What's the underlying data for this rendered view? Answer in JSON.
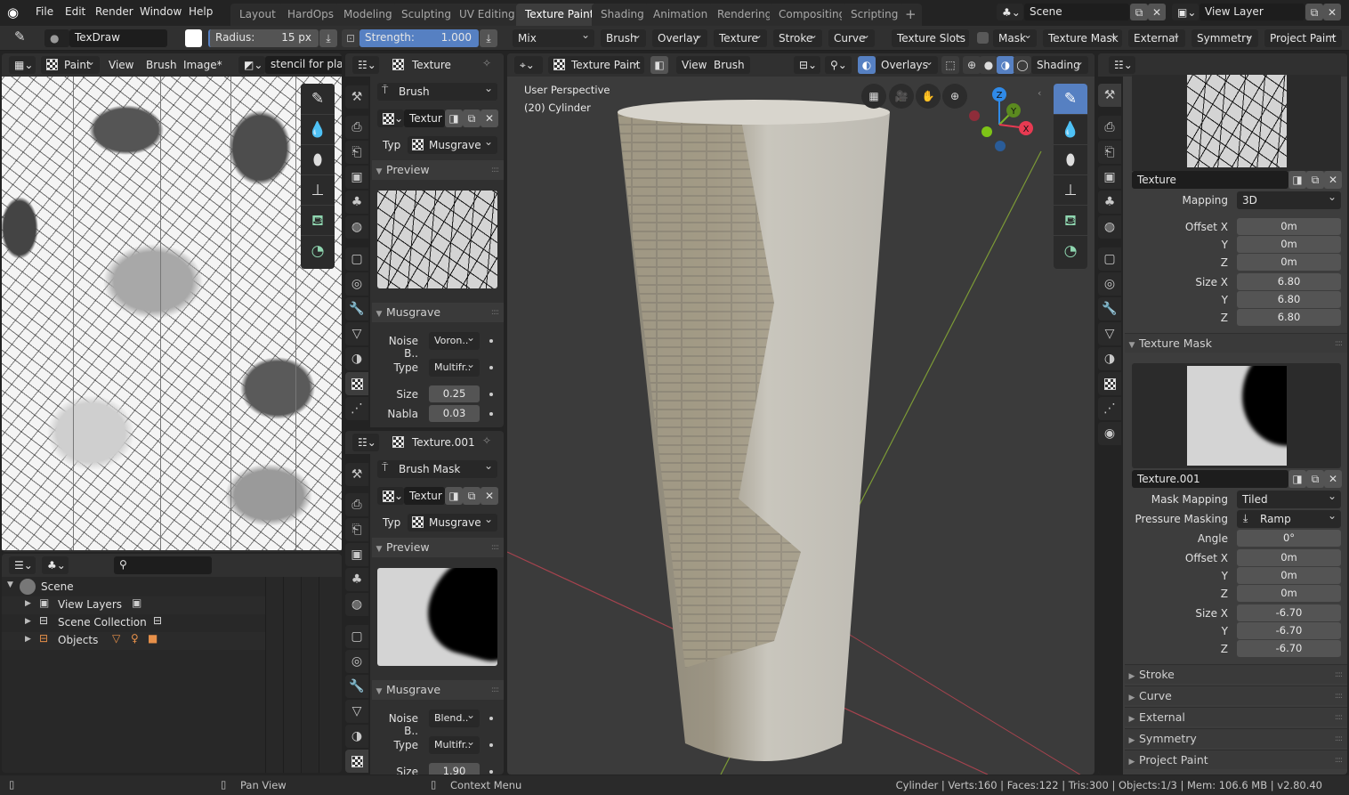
{
  "app": {
    "logo": "blender-logo-icon"
  },
  "menu": [
    "File",
    "Edit",
    "Render",
    "Window",
    "Help"
  ],
  "workspaces": {
    "tabs": [
      "Layout",
      "HardOps",
      "Modeling",
      "Sculpting",
      "UV Editing",
      "Texture Paint",
      "Shading",
      "Animation",
      "Rendering",
      "Compositing",
      "Scripting"
    ],
    "active": "Texture Paint",
    "add_label": "+"
  },
  "scene": {
    "name": "Scene",
    "view_layer": "View Layer"
  },
  "tool_settings": {
    "brush_name": "TexDraw",
    "color": "#ffffff",
    "radius_label": "Radius:",
    "radius_value": "15 px",
    "strength_label": "Strength:",
    "strength_value": "1.000",
    "strength_fraction": 1.0,
    "blend": "Mix",
    "popovers": [
      "Brush",
      "Overlay",
      "Texture",
      "Stroke",
      "Curve"
    ],
    "right_popovers": [
      "Texture Slots",
      "Mask",
      "Texture Mask",
      "External",
      "Symmetry",
      "Project Paint"
    ]
  },
  "image_editor": {
    "mode": "Paint",
    "menus": [
      "View",
      "Brush",
      "Image*"
    ],
    "image_name": "stencil for plaste"
  },
  "outliner": {
    "search_placeholder": "",
    "rows": [
      {
        "label": "Scene",
        "expanded": true
      },
      {
        "label": "View Layers"
      },
      {
        "label": "Scene Collection"
      },
      {
        "label": "Objects"
      }
    ]
  },
  "texture_panel_1": {
    "title": "Texture",
    "context": "Brush",
    "texture_name": "Textur",
    "type_label": "Typ",
    "type_value": "Musgrave",
    "preview_label": "Preview",
    "section": "Musgrave",
    "fields": [
      {
        "label": "Noise B..",
        "value": "Voron..",
        "kind": "dropdown"
      },
      {
        "label": "Type",
        "value": "Multifr..",
        "kind": "dropdown"
      },
      {
        "label": "Size",
        "value": "0.25",
        "kind": "number"
      },
      {
        "label": "Nabla",
        "value": "0.03",
        "kind": "number"
      }
    ]
  },
  "texture_panel_2": {
    "title": "Texture.001",
    "context": "Brush Mask",
    "texture_name": "Textur",
    "type_label": "Typ",
    "type_value": "Musgrave",
    "preview_label": "Preview",
    "section": "Musgrave",
    "fields": [
      {
        "label": "Noise B..",
        "value": "Blend..",
        "kind": "dropdown"
      },
      {
        "label": "Type",
        "value": "Multifr..",
        "kind": "dropdown"
      },
      {
        "label": "Size",
        "value": "1.90",
        "kind": "number"
      }
    ]
  },
  "viewport": {
    "mode": "Texture Paint",
    "menus": [
      "View",
      "Brush"
    ],
    "overlays_label": "Overlays",
    "shading_label": "Shading",
    "perspective_text": "User Perspective",
    "object_text": "(20) Cylinder",
    "gizmo": {
      "x": "X",
      "y": "Y",
      "z": "Z",
      "x_color": "#e83a52",
      "y_color": "#7ab526",
      "z_color": "#2f8ae8"
    }
  },
  "properties": {
    "texture": {
      "name": "Texture",
      "mapping_label": "Mapping",
      "mapping_value": "3D",
      "offset": {
        "label": "Offset X",
        "x": "0m",
        "y": "0m",
        "z": "0m"
      },
      "size": {
        "label": "Size X",
        "x": "6.80",
        "y": "6.80",
        "z": "6.80"
      }
    },
    "texture_mask": {
      "title": "Texture Mask",
      "name": "Texture.001",
      "mask_mapping_label": "Mask Mapping",
      "mask_mapping_value": "Tiled",
      "pressure_label": "Pressure Masking",
      "pressure_value": "Ramp",
      "angle_label": "Angle",
      "angle_value": "0°",
      "offset": {
        "label": "Offset X",
        "x": "0m",
        "y": "0m",
        "z": "0m"
      },
      "size": {
        "label": "Size X",
        "x": "-6.70",
        "y": "-6.70",
        "z": "-6.70"
      }
    },
    "collapsed_panels": [
      "Stroke",
      "Curve",
      "External",
      "Symmetry",
      "Project Paint"
    ],
    "axis_labels": {
      "y": "Y",
      "z": "Z"
    }
  },
  "statusbar": {
    "pan": "Pan View",
    "context": "Context Menu",
    "stats": "Cylinder | Verts:160 | Faces:122 | Tris:300 | Objects:1/3 | Mem: 106.6 MB | v2.80.40"
  },
  "colors": {
    "accent": "#5680c2",
    "header": "#303030",
    "bg": "#232323"
  }
}
